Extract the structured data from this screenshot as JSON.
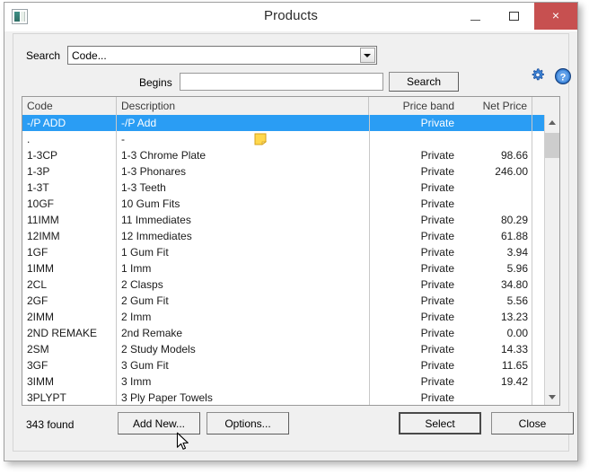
{
  "window": {
    "title": "Products",
    "app_icon": "application-icon",
    "controls": {
      "minimize": "minimize-icon",
      "maximize": "maximize-icon",
      "close": "×"
    }
  },
  "toolbar": {
    "gear_icon": "gear-icon",
    "help_icon": "help-icon"
  },
  "search": {
    "search_label": "Search",
    "search_field_value": "Code...",
    "begins_label": "Begins",
    "begins_value": "",
    "begins_placeholder": "",
    "search_button_label": "Search"
  },
  "grid": {
    "columns": [
      "Code",
      "Description",
      "Price band",
      "Net Price",
      ""
    ],
    "rows": [
      {
        "code": "-/P ADD",
        "description": "-/P Add",
        "band": "Private",
        "net": "",
        "note": false,
        "selected": true
      },
      {
        "code": ".",
        "description": "-",
        "band": "",
        "net": "",
        "note": true,
        "selected": false
      },
      {
        "code": "1-3CP",
        "description": "1-3 Chrome Plate",
        "band": "Private",
        "net": "98.66",
        "note": false,
        "selected": false
      },
      {
        "code": "1-3P",
        "description": "1-3 Phonares",
        "band": "Private",
        "net": "246.00",
        "note": false,
        "selected": false
      },
      {
        "code": "1-3T",
        "description": "1-3 Teeth",
        "band": "Private",
        "net": "",
        "note": false,
        "selected": false
      },
      {
        "code": "10GF",
        "description": "10 Gum Fits",
        "band": "Private",
        "net": "",
        "note": false,
        "selected": false
      },
      {
        "code": "11IMM",
        "description": "11 Immediates",
        "band": "Private",
        "net": "80.29",
        "note": false,
        "selected": false
      },
      {
        "code": "12IMM",
        "description": "12 Immediates",
        "band": "Private",
        "net": "61.88",
        "note": false,
        "selected": false
      },
      {
        "code": "1GF",
        "description": "1 Gum Fit",
        "band": "Private",
        "net": "3.94",
        "note": false,
        "selected": false
      },
      {
        "code": "1IMM",
        "description": "1 Imm",
        "band": "Private",
        "net": "5.96",
        "note": false,
        "selected": false
      },
      {
        "code": "2CL",
        "description": "2 Clasps",
        "band": "Private",
        "net": "34.80",
        "note": false,
        "selected": false
      },
      {
        "code": "2GF",
        "description": "2 Gum Fit",
        "band": "Private",
        "net": "5.56",
        "note": false,
        "selected": false
      },
      {
        "code": "2IMM",
        "description": "2 Imm",
        "band": "Private",
        "net": "13.23",
        "note": false,
        "selected": false
      },
      {
        "code": "2ND REMAKE",
        "description": "2nd Remake",
        "band": "Private",
        "net": "0.00",
        "note": false,
        "selected": false
      },
      {
        "code": "2SM",
        "description": "2 Study Models",
        "band": "Private",
        "net": "14.33",
        "note": false,
        "selected": false
      },
      {
        "code": "3GF",
        "description": "3 Gum Fit",
        "band": "Private",
        "net": "11.65",
        "note": false,
        "selected": false
      },
      {
        "code": "3IMM",
        "description": "3 Imm",
        "band": "Private",
        "net": "19.42",
        "note": false,
        "selected": false
      },
      {
        "code": "3PLYPT",
        "description": "3 Ply Paper Towels",
        "band": "Private",
        "net": "",
        "note": false,
        "selected": false
      }
    ]
  },
  "footer": {
    "found_label": "343  found",
    "add_new_label": "Add New...",
    "options_label": "Options...",
    "select_label": "Select",
    "close_label": "Close"
  },
  "colors": {
    "selection": "#2a9df4",
    "close_button": "#c75050",
    "window_bg": "#f0f0f0",
    "accent_icon": "#2a6fd4"
  }
}
